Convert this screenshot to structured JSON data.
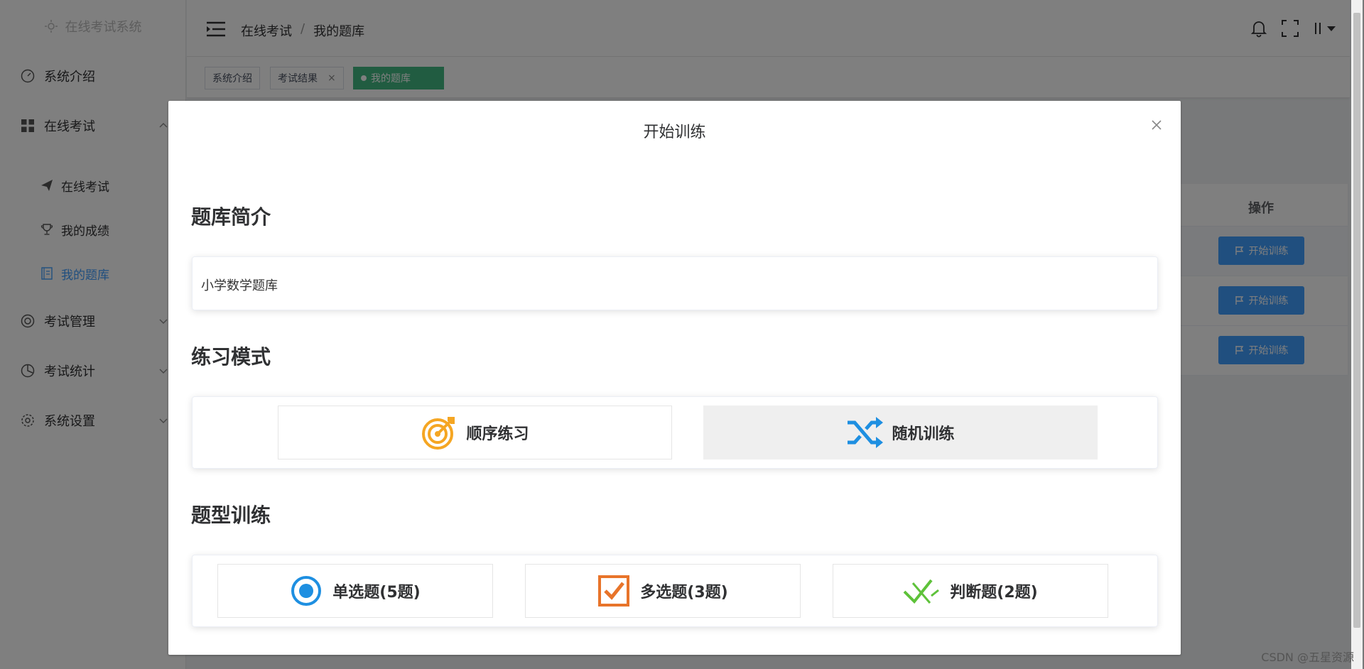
{
  "app": {
    "title": "在线考试系统"
  },
  "sidebar": {
    "items": [
      {
        "label": "系统介绍",
        "icon": "dashboard-icon"
      },
      {
        "label": "在线考试",
        "icon": "grid-icon"
      },
      {
        "label": "考试管理",
        "icon": "lifebuoy-icon"
      },
      {
        "label": "考试统计",
        "icon": "pie-chart-icon"
      },
      {
        "label": "系统设置",
        "icon": "gear-icon"
      }
    ],
    "sub_items": [
      {
        "label": "在线考试",
        "icon": "paper-plane-icon"
      },
      {
        "label": "我的成绩",
        "icon": "trophy-icon"
      },
      {
        "label": "我的题库",
        "icon": "book-icon"
      }
    ]
  },
  "header": {
    "breadcrumb": [
      "在线考试",
      "我的题库"
    ],
    "breadcrumb_sep": "/"
  },
  "tags": [
    {
      "label": "系统介绍"
    },
    {
      "label": "考试结果",
      "close": "×"
    },
    {
      "label": "我的题库"
    }
  ],
  "table": {
    "op_header": "操作",
    "rows": [
      {
        "button": "开始训练"
      },
      {
        "button": "开始训练"
      },
      {
        "button": "开始训练"
      }
    ]
  },
  "dialog": {
    "title": "开始训练",
    "intro_heading": "题库简介",
    "intro_text": "小学数学题库",
    "mode_heading": "练习模式",
    "modes": [
      {
        "label": "顺序练习",
        "icon": "target-icon",
        "color": "#f5a623"
      },
      {
        "label": "随机训练",
        "icon": "shuffle-icon",
        "color": "#1e8fe1"
      }
    ],
    "type_heading": "题型训练",
    "types": [
      {
        "label": "单选题(5题)",
        "icon": "radio-icon",
        "color": "#1e8fe1"
      },
      {
        "label": "多选题(3题)",
        "icon": "checkbox-icon",
        "color": "#e8742a"
      },
      {
        "label": "判断题(2题)",
        "icon": "judge-check-icon",
        "color": "#5ec23a"
      }
    ]
  },
  "watermark": "CSDN @五星资源",
  "colors": {
    "primary": "#409eff",
    "tag_active": "#42b983"
  }
}
